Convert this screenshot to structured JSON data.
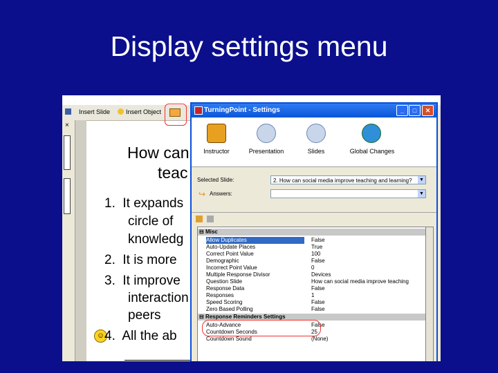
{
  "slide": {
    "title": "Display settings menu"
  },
  "powerpoint": {
    "toolbar": {
      "insert_slide": "Insert Slide",
      "insert_object": "Insert Object",
      "close": "×"
    },
    "question_line1": "How can",
    "question_line2": "teac",
    "answers": [
      "1.  It expands",
      "circle of",
      "knowledg",
      "2.  It is more",
      "3.  It improve",
      "interaction",
      "peers",
      "4.  All the ab"
    ]
  },
  "dialog": {
    "title": "TurningPoint - Settings",
    "tabs": [
      {
        "label": "Instructor",
        "icon": "instructor-icon"
      },
      {
        "label": "Presentation",
        "icon": "presentation-gear-icon"
      },
      {
        "label": "Slides",
        "icon": "slides-gear-icon"
      },
      {
        "label": "Global Changes",
        "icon": "globe-icon"
      }
    ],
    "selected_slide_label": "Selected Slide:",
    "selected_slide_value": "2. How can social media improve teaching and learning?",
    "answers_label": "Answers:",
    "answers_value": "",
    "categories": {
      "misc": "Misc",
      "reminders": "Response Reminders Settings"
    },
    "misc_rows": [
      {
        "key": "Allow Duplicates",
        "value": "False"
      },
      {
        "key": "Auto-Update Places",
        "value": "True"
      },
      {
        "key": "Correct Point Value",
        "value": "100"
      },
      {
        "key": "Demographic",
        "value": "False"
      },
      {
        "key": "Incorrect Point Value",
        "value": "0"
      },
      {
        "key": "Multiple Response Divisor",
        "value": "Devices"
      },
      {
        "key": "Question Slide",
        "value": "How can social media improve teaching"
      },
      {
        "key": "Response Data",
        "value": "False"
      },
      {
        "key": "Responses",
        "value": "1"
      },
      {
        "key": "Speed Scoring",
        "value": "False"
      },
      {
        "key": "Zero Based Polling",
        "value": "False"
      }
    ],
    "reminder_rows": [
      {
        "key": "Auto-Advance",
        "value": "False"
      },
      {
        "key": "Countdown Seconds",
        "value": "25"
      },
      {
        "key": "Countdown Sound",
        "value": "(None)"
      }
    ]
  },
  "colors": {
    "background": "#0b0f8c",
    "title_bar": "#0a55d9",
    "highlight_ring": "#e33333",
    "selected_row": "#316ac5"
  }
}
